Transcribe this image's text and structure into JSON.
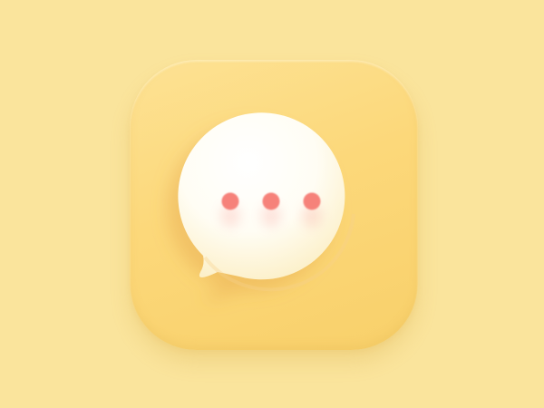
{
  "icon": {
    "name": "chat-bubble",
    "background_color": "#fae49c",
    "tile_color": "#fcd87a",
    "bubble_color": "#fffdf6",
    "dot_color": "#f6827a",
    "dot_count": 3
  }
}
